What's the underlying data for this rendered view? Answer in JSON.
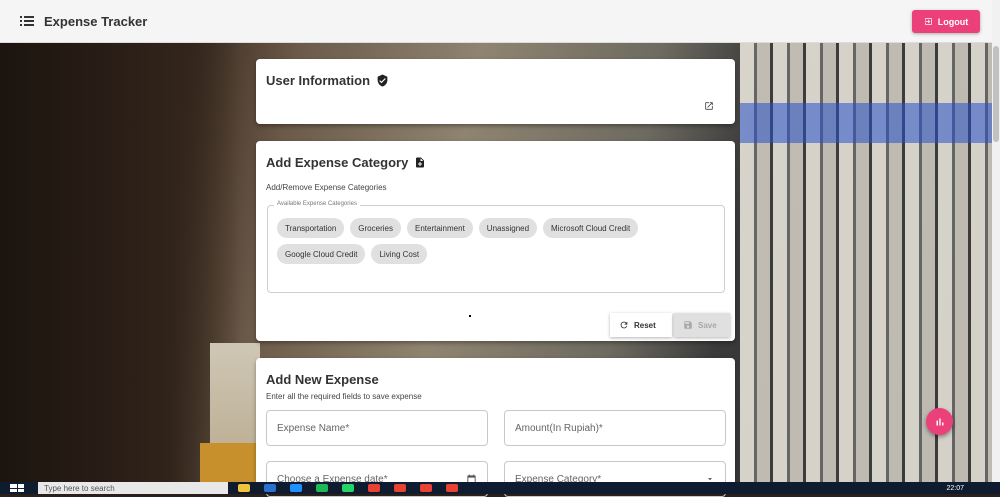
{
  "app": {
    "title": "Expense Tracker",
    "logout_label": "Logout",
    "accent_color": "#ec407a"
  },
  "user_card": {
    "title": "User Information",
    "title_icon": "verified-user-icon",
    "action_icon": "open-in-new-icon"
  },
  "category_card": {
    "title": "Add Expense Category",
    "title_icon": "document-icon",
    "subtitle": "Add/Remove Expense Categories",
    "fieldset_label": "Available Expense Categories",
    "categories": [
      "Transportation",
      "Groceries",
      "Entertainment",
      "Unassigned",
      "Microsoft Cloud Credit",
      "Google Cloud Credit",
      "Living Cost"
    ],
    "reset_label": "Reset",
    "save_label": "Save"
  },
  "expense_card": {
    "title": "Add New Expense",
    "subtitle": "Enter all the required fields to save expense",
    "fields": {
      "name_placeholder": "Expense Name*",
      "amount_placeholder": "Amount(In Rupiah)*",
      "date_placeholder": "Choose a Expense date*",
      "category_placeholder": "Expense Category*"
    }
  },
  "taskbar": {
    "search_placeholder": "Type here to search",
    "clock": "22:07"
  }
}
